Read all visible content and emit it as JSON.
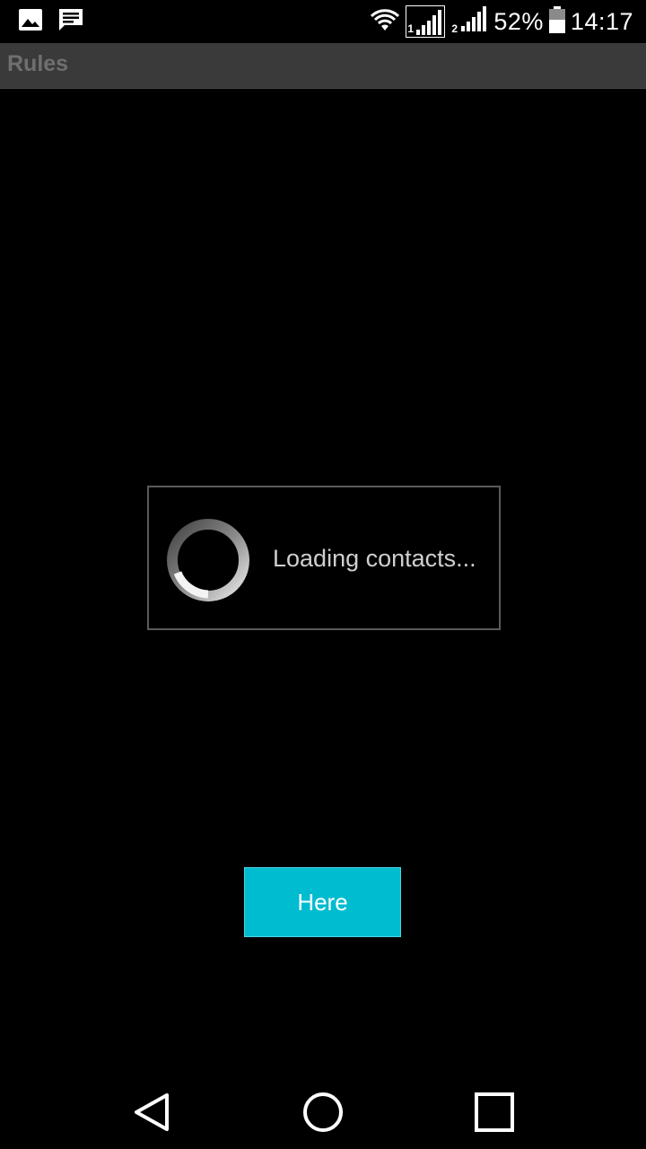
{
  "status_bar": {
    "icons_left": [
      "image-icon",
      "message-icon"
    ],
    "icons_right": [
      "wifi-icon",
      "signal-sim1-icon",
      "signal-sim2-icon",
      "battery-icon"
    ],
    "sim1_label": "1",
    "sim2_label": "2",
    "battery_percent": "52%",
    "time": "14:17"
  },
  "action_bar": {
    "title": "Rules"
  },
  "dialog": {
    "message": "Loading contacts..."
  },
  "main": {
    "here_button_label": "Here"
  },
  "nav_bar": {
    "icons": [
      "back-icon",
      "home-icon",
      "recents-icon"
    ]
  },
  "colors": {
    "background": "#000000",
    "action_bar": "#3a3a3a",
    "action_bar_title": "#6f6f6f",
    "button_accent": "#00bcd0"
  }
}
